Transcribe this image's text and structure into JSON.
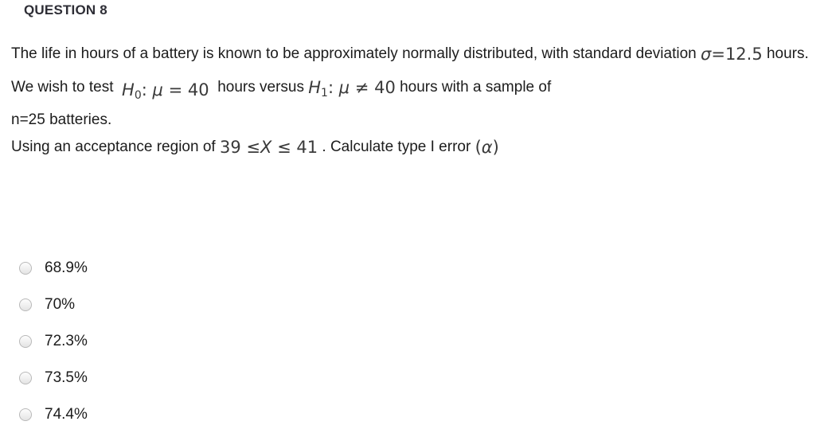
{
  "heading": {
    "label": "QUESTION 8"
  },
  "stem": {
    "paragraph1": {
      "before_sigma": "The life in hours of a battery is known to be approximately normally distributed, with standard deviation",
      "sigma_symbol": "σ",
      "equals": "=",
      "sigma_value": "12.5",
      "after_sigma": "hours."
    },
    "paragraph2": {
      "lead": "We wish to test",
      "h0_symbol": "H",
      "h0_subscript": "0",
      "h0_colon": ":",
      "h0_mu": "μ",
      "h0_relation": "=",
      "h0_value": "40",
      "mid1": "hours",
      "versus": "versus",
      "h1_symbol": "H",
      "h1_subscript": "1",
      "h1_colon": ":",
      "h1_mu": "μ",
      "h1_relation": "≠",
      "h1_value": "40",
      "mid2": "hours",
      "with": "with",
      "article": "a",
      "sample": "sample",
      "of": "of",
      "tail": "n=25 batteries."
    },
    "paragraph3": {
      "lead": "Using an acceptance region of",
      "lower_bound": "39",
      "rel_left": "≤",
      "variable": "X",
      "rel_right": "≤",
      "upper_bound": "41",
      "period": ".",
      "task": "Calculate type I error",
      "alpha_open": "(",
      "alpha": "α",
      "alpha_close": ")"
    }
  },
  "options": [
    {
      "id": "option-a",
      "label": "68.9%",
      "selected": false
    },
    {
      "id": "option-b",
      "label": "70%",
      "selected": false
    },
    {
      "id": "option-c",
      "label": "72.3%",
      "selected": false
    },
    {
      "id": "option-d",
      "label": "73.5%",
      "selected": false
    },
    {
      "id": "option-e",
      "label": "74.4%",
      "selected": false
    }
  ],
  "colors": {
    "background": "#ffffff",
    "heading_text": "#2e2e36",
    "body_text": "#1c1c1c",
    "math_text": "#3a3a3a",
    "radio_border": "#b9b9b9"
  }
}
